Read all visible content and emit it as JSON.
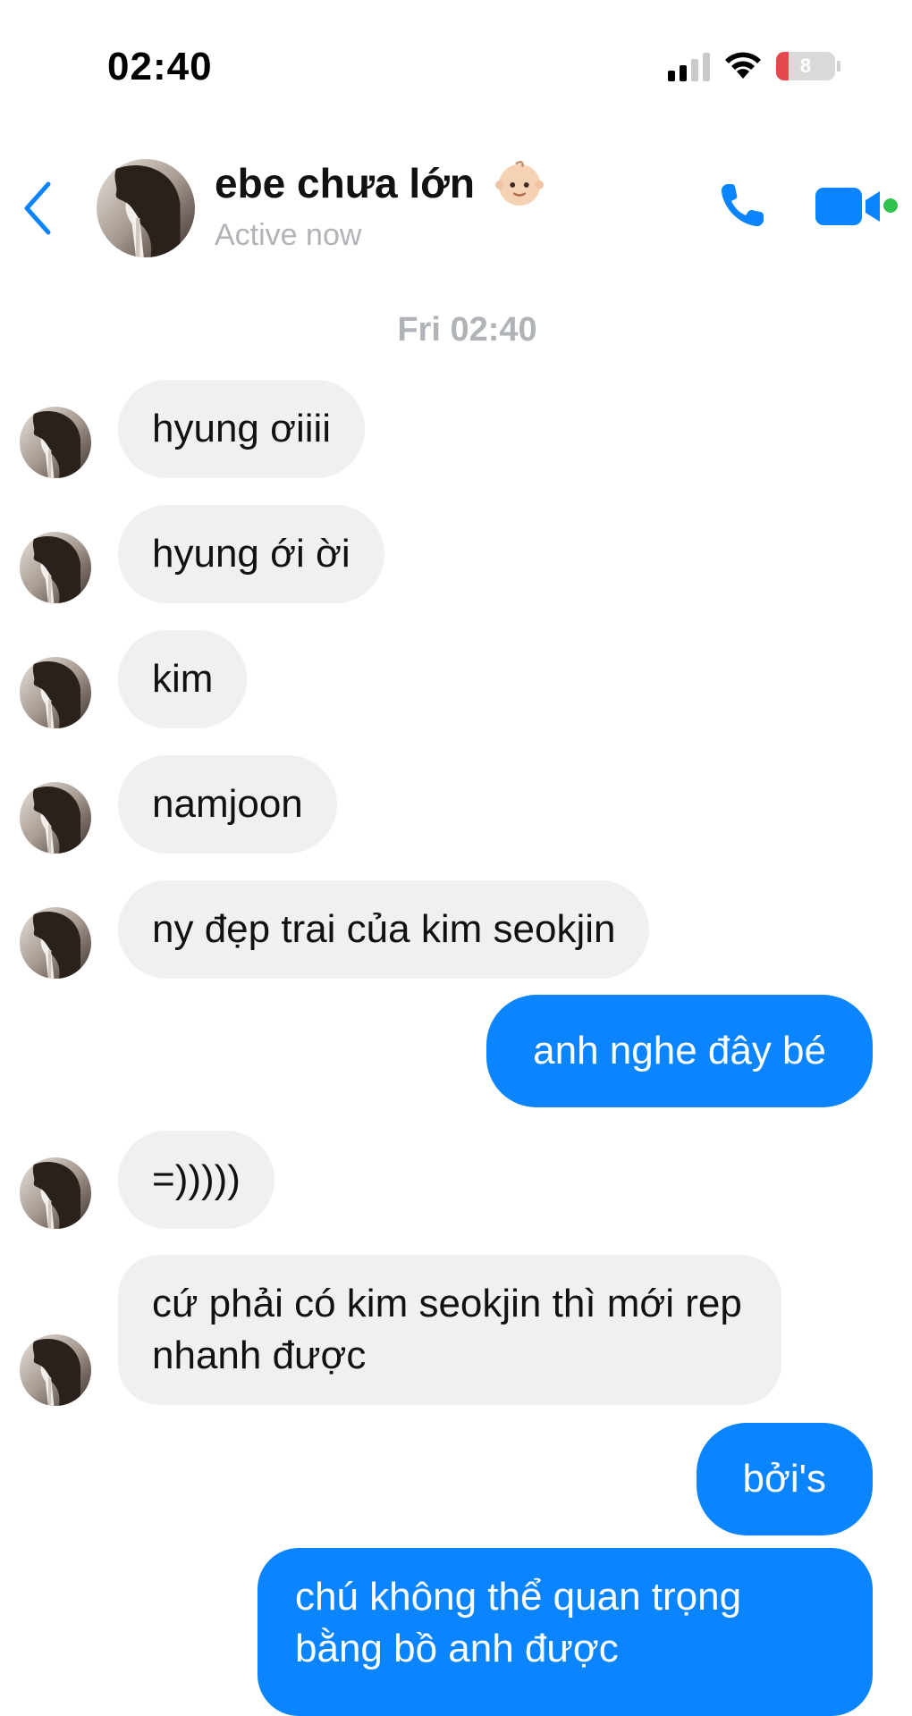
{
  "status_bar": {
    "time": "02:40",
    "battery_level": "8"
  },
  "header": {
    "name": "ebe chưa lớn",
    "status": "Active now"
  },
  "icons": {
    "back": "chevron-left-icon",
    "phone": "phone-icon",
    "video": "video-camera-icon",
    "emoji": "baby-emoji-icon"
  },
  "colors": {
    "accent": "#0a84ff",
    "incoming_bubble": "#f0f0f0",
    "online": "#31c24d"
  },
  "date_label": "Fri 02:40",
  "messages": [
    {
      "from": "them",
      "text": "hyung ơiiii"
    },
    {
      "from": "them",
      "text": "hyung ới ời"
    },
    {
      "from": "them",
      "text": "kim"
    },
    {
      "from": "them",
      "text": "namjoon"
    },
    {
      "from": "them",
      "text": "ny đẹp trai của kim seokjin"
    },
    {
      "from": "me",
      "text": "anh nghe đây bé"
    },
    {
      "from": "them",
      "text": "=)))))"
    },
    {
      "from": "them",
      "text": "cứ phải có kim seokjin thì mới rep nhanh được"
    },
    {
      "from": "me",
      "text": "bởi's"
    },
    {
      "from": "me",
      "text": "chú không thể quan trọng bằng bồ anh được"
    }
  ]
}
